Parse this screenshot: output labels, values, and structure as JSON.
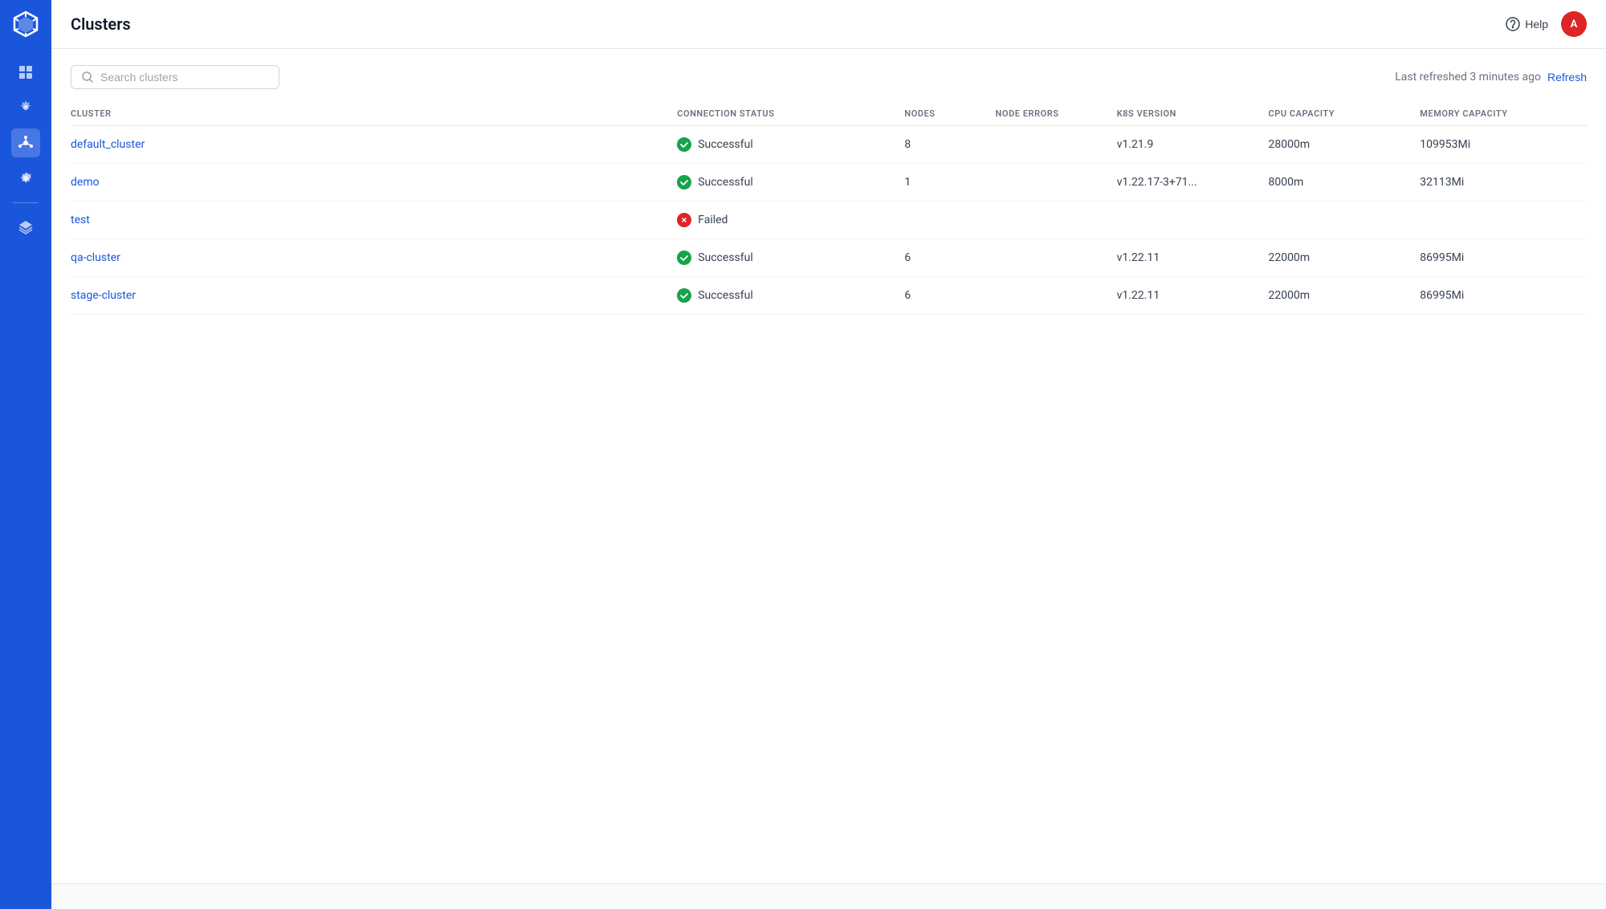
{
  "sidebar": {
    "logo_text": "⬡",
    "icons": [
      {
        "name": "grid-icon",
        "symbol": "⊞",
        "active": false
      },
      {
        "name": "settings-icon",
        "symbol": "✦",
        "active": false
      },
      {
        "name": "cluster-icon",
        "symbol": "❋",
        "active": true
      },
      {
        "name": "gear-icon",
        "symbol": "⚙",
        "active": false
      },
      {
        "name": "layers-icon",
        "symbol": "⧉",
        "active": false
      }
    ]
  },
  "header": {
    "title": "Clusters",
    "help_label": "Help",
    "avatar_initials": "A"
  },
  "toolbar": {
    "search_placeholder": "Search clusters",
    "last_refreshed_text": "Last refreshed 3 minutes ago",
    "refresh_label": "Refresh"
  },
  "table": {
    "columns": [
      {
        "key": "cluster",
        "label": "CLUSTER"
      },
      {
        "key": "connection_status",
        "label": "CONNECTION STATUS"
      },
      {
        "key": "nodes",
        "label": "NODES"
      },
      {
        "key": "node_errors",
        "label": "NODE ERRORS"
      },
      {
        "key": "k8s_version",
        "label": "K8S VERSION"
      },
      {
        "key": "cpu_capacity",
        "label": "CPU CAPACITY"
      },
      {
        "key": "memory_capacity",
        "label": "MEMORY CAPACITY"
      }
    ],
    "rows": [
      {
        "cluster": "default_cluster",
        "status": "Successful",
        "status_type": "success",
        "nodes": "8",
        "node_errors": "",
        "k8s_version": "v1.21.9",
        "cpu_capacity": "28000m",
        "memory_capacity": "109953Mi"
      },
      {
        "cluster": "demo",
        "status": "Successful",
        "status_type": "success",
        "nodes": "1",
        "node_errors": "",
        "k8s_version": "v1.22.17-3+71...",
        "cpu_capacity": "8000m",
        "memory_capacity": "32113Mi"
      },
      {
        "cluster": "test",
        "status": "Failed",
        "status_type": "failed",
        "nodes": "",
        "node_errors": "",
        "k8s_version": "",
        "cpu_capacity": "",
        "memory_capacity": ""
      },
      {
        "cluster": "qa-cluster",
        "status": "Successful",
        "status_type": "success",
        "nodes": "6",
        "node_errors": "",
        "k8s_version": "v1.22.11",
        "cpu_capacity": "22000m",
        "memory_capacity": "86995Mi"
      },
      {
        "cluster": "stage-cluster",
        "status": "Successful",
        "status_type": "success",
        "nodes": "6",
        "node_errors": "",
        "k8s_version": "v1.22.11",
        "cpu_capacity": "22000m",
        "memory_capacity": "86995Mi"
      }
    ]
  }
}
